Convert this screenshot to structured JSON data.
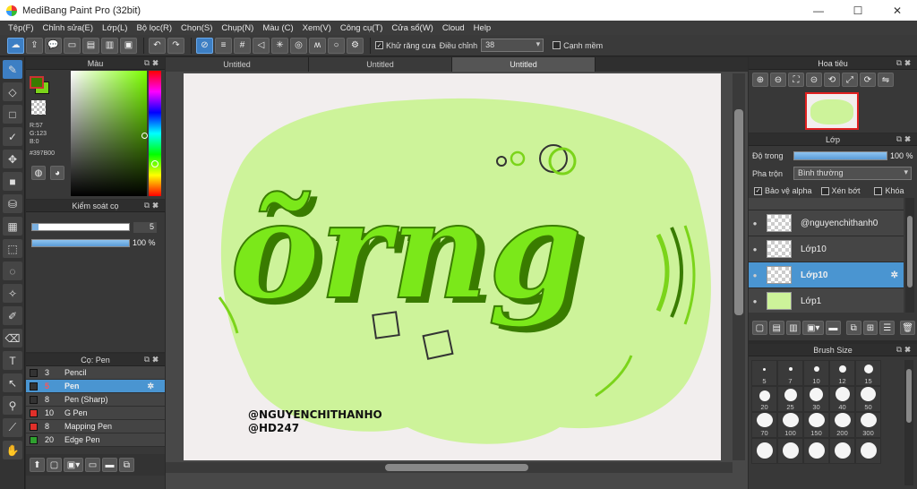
{
  "window": {
    "title": "MediBang Paint Pro (32bit)",
    "min": "—",
    "max": "☐",
    "close": "✕"
  },
  "menu": [
    "Tệp(F)",
    "Chỉnh sửa(E)",
    "Lớp(L)",
    "Bộ lọc(R)",
    "Chọn(S)",
    "Chụp(N)",
    "Màu (C)",
    "Xem(V)",
    "Công cụ(T)",
    "Cửa sổ(W)",
    "Cloud",
    "Help"
  ],
  "toolbar": {
    "antialias_label": "Khử răng cưa",
    "adjust_label": "Điều chỉnh",
    "adjust_value": "38",
    "smooth_label": "Cạnh mềm"
  },
  "color_panel": {
    "title": "Màu",
    "r": "R:57",
    "g": "G:123",
    "b": "B:0",
    "hex": "#397B00",
    "fg": "#397b00",
    "bg": "#7bd41a"
  },
  "brush_control": {
    "title": "Kiểm soát cọ",
    "size_value": "5",
    "opacity_value": "100 %"
  },
  "brush_panel": {
    "title": "Cọ: Pen",
    "items": [
      {
        "size": "3",
        "name": "Pencil",
        "color": "#333333"
      },
      {
        "size": "5",
        "name": "Pen",
        "color": "#333333"
      },
      {
        "size": "8",
        "name": "Pen (Sharp)",
        "color": "#333333"
      },
      {
        "size": "10",
        "name": "G Pen",
        "color": "#e0302a"
      },
      {
        "size": "8",
        "name": "Mapping Pen",
        "color": "#e0302a"
      },
      {
        "size": "20",
        "name": "Edge Pen",
        "color": "#2fa02f"
      }
    ]
  },
  "tabs": [
    "Untitled",
    "Untitled",
    "Untitled"
  ],
  "canvas": {
    "text_big": "õrng",
    "signature1": "@NGUYENCHITHANHO",
    "signature2": "@HD247"
  },
  "navigator": {
    "title": "Hoa tiêu"
  },
  "layers": {
    "title": "Lớp",
    "opacity_label": "Độ trong",
    "opacity_value": "100 %",
    "blend_label": "Pha trộn",
    "blend_value": "Bình thường",
    "protect_alpha": "Bảo vệ alpha",
    "clip": "Xén bớt",
    "lock": "Khóa",
    "items": [
      "@nguyenchithanh0",
      "Lớp10",
      "Lớp10",
      "Lớp1"
    ]
  },
  "brush_size": {
    "title": "Brush Size",
    "sizes": [
      "5",
      "7",
      "10",
      "12",
      "15",
      "20",
      "25",
      "30",
      "40",
      "50",
      "70",
      "100",
      "150",
      "200",
      "300"
    ]
  }
}
